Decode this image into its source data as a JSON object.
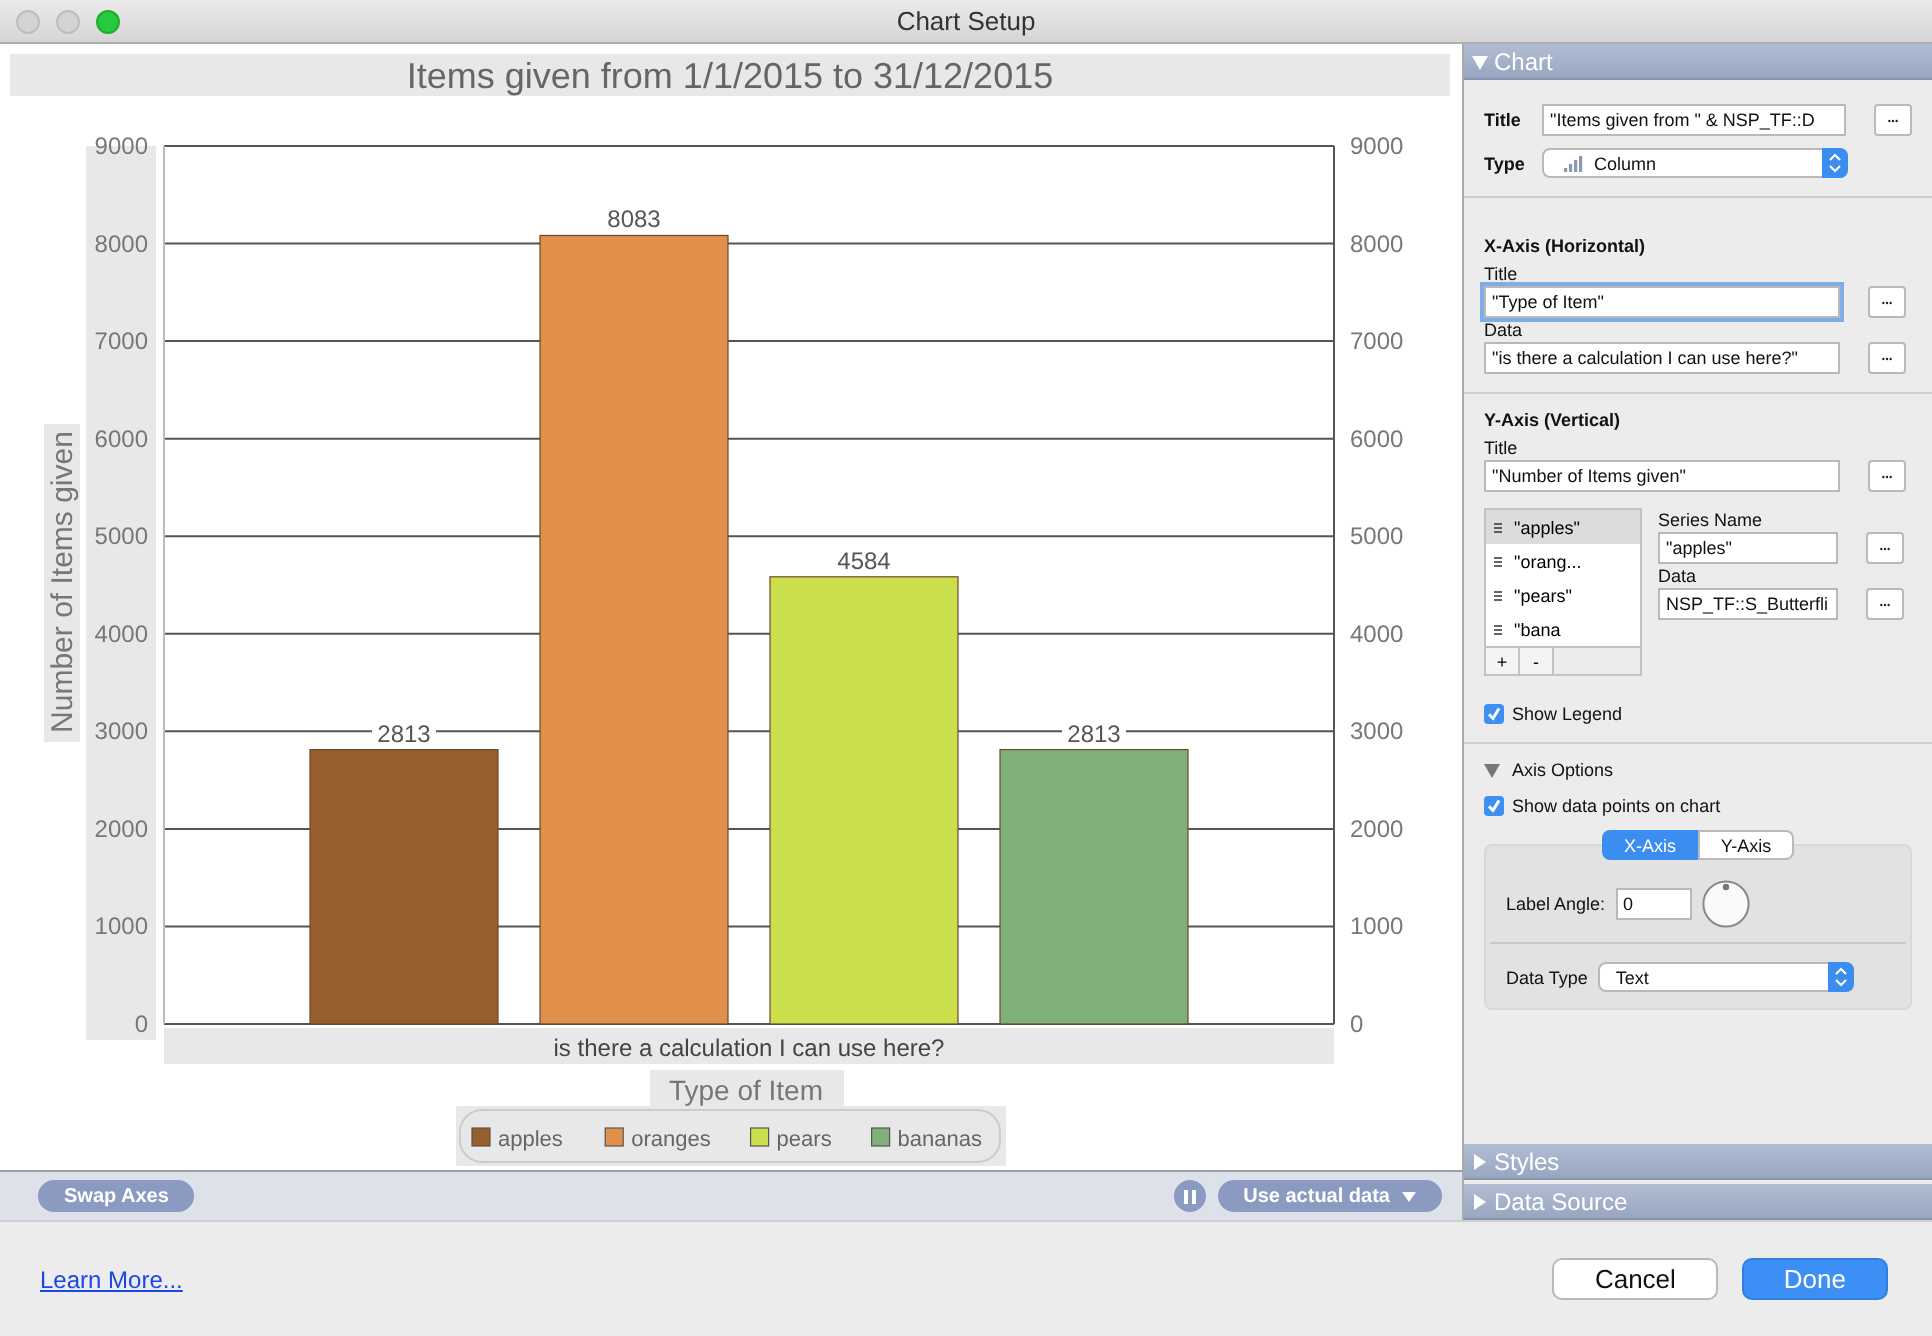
{
  "window": {
    "title": "Chart Setup"
  },
  "chart": {
    "chart_data": {
      "type": "bar",
      "title": "Items given from 1/1/2015 to 31/12/2015",
      "xlabel": "Type of Item",
      "ylabel": "Number of Items given",
      "categories": [
        "is there a calculation I can use here?"
      ],
      "series": [
        {
          "name": "apples",
          "color": "#965f2b",
          "values": [
            2813
          ]
        },
        {
          "name": "oranges",
          "color": "#e0904a",
          "values": [
            8083
          ]
        },
        {
          "name": "pears",
          "color": "#cbdf4c",
          "values": [
            4584
          ]
        },
        {
          "name": "bananas",
          "color": "#7eb077",
          "values": [
            2813
          ]
        }
      ],
      "ylim": [
        0,
        9000
      ],
      "yticks": [
        0,
        1000,
        2000,
        3000,
        4000,
        5000,
        6000,
        7000,
        8000,
        9000
      ],
      "grid": true,
      "legend": true,
      "data_labels": true
    },
    "right_axis_labels": [
      "9000",
      "8000",
      "7000",
      "6000",
      "5000",
      "4000",
      "3000",
      "2000",
      "1000",
      "0"
    ]
  },
  "toolbar": {
    "swap_axes": "Swap Axes",
    "data_mode": "Use actual data"
  },
  "panel": {
    "chart_section": {
      "heading": "Chart",
      "expanded": true,
      "title_label": "Title",
      "title_value": "\"Items given from \" & NSP_TF::D",
      "type_label": "Type",
      "type_value": "Column"
    },
    "x_axis": {
      "heading": "X-Axis (Horizontal)",
      "title_label": "Title",
      "title_value": "\"Type of Item\"",
      "title_focused": true,
      "data_label": "Data",
      "data_value": "\"is there a calculation I can use here?\""
    },
    "y_axis": {
      "heading": "Y-Axis (Vertical)",
      "title_label": "Title",
      "title_value": "\"Number of Items given\"",
      "series": [
        {
          "label": "\"apples\"",
          "selected": true
        },
        {
          "label": "\"orang...",
          "selected": false
        },
        {
          "label": "\"pears\"",
          "selected": false
        },
        {
          "label": "\"bana",
          "selected": false
        }
      ],
      "add": "+",
      "remove": "-",
      "series_name_label": "Series Name",
      "series_name_value": "\"apples\"",
      "data_label": "Data",
      "data_value": "NSP_TF::S_Butterfli",
      "show_legend": {
        "label": "Show Legend",
        "checked": true
      }
    },
    "axis_options": {
      "heading": "Axis Options",
      "expanded": true,
      "show_data_points": {
        "label": "Show data points on chart",
        "checked": true
      },
      "tabs": [
        {
          "label": "X-Axis",
          "selected": true
        },
        {
          "label": "Y-Axis",
          "selected": false
        }
      ],
      "label_angle_label": "Label Angle:",
      "label_angle_value": "0",
      "data_type_label": "Data Type",
      "data_type_value": "Text"
    },
    "collapsed_sections": [
      {
        "heading": "Styles",
        "expanded": false
      },
      {
        "heading": "Data Source",
        "expanded": false
      }
    ]
  },
  "footer": {
    "link": "Learn More...",
    "buttons": [
      {
        "label": "Cancel",
        "primary": false
      },
      {
        "label": "Done",
        "primary": true
      }
    ]
  }
}
